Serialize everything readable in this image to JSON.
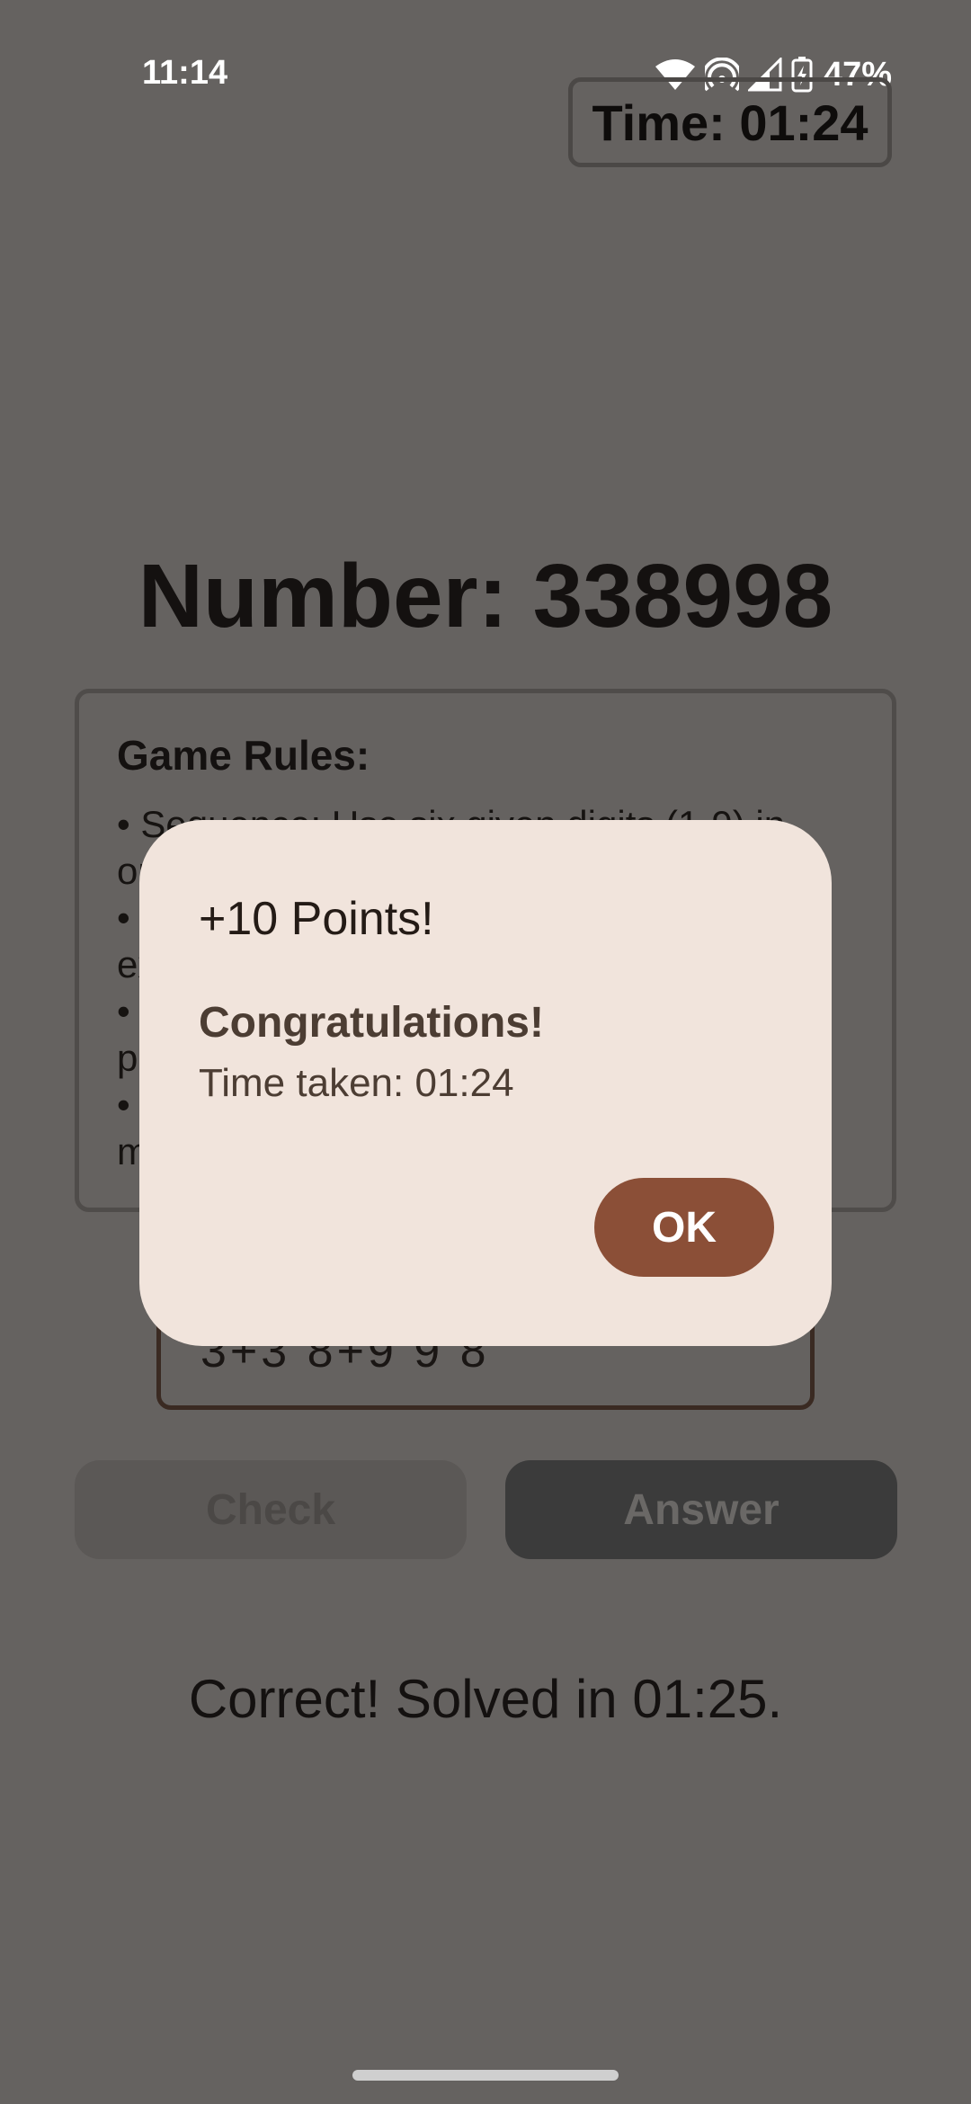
{
  "status_bar": {
    "time": "11:14",
    "battery_percent": "47%",
    "icons": [
      "wifi-icon",
      "hotspot-icon",
      "signal-icon",
      "battery-charging-icon"
    ]
  },
  "timer": {
    "label": "Time: 01:24"
  },
  "number": {
    "label": "Number: 338998"
  },
  "rules": {
    "title": "Game Rules:",
    "items": [
      "• Sequence: Use six given digits (1-9) in",
      "or",
      "•",
      "ex",
      "•",
      "p",
      "•",
      "m"
    ]
  },
  "answer": {
    "value": "3+3 8+9 9 8"
  },
  "buttons": {
    "check": "Check",
    "answer": "Answer"
  },
  "result": {
    "text": "Correct! Solved in 01:25."
  },
  "dialog": {
    "title": "+10 Points!",
    "heading": "Congratulations!",
    "body": "Time taken: 01:24",
    "ok_label": "OK"
  },
  "colors": {
    "scrim_background": "#656260",
    "dialog_background": "#f1e4dc",
    "ok_button": "#8b4f37"
  }
}
